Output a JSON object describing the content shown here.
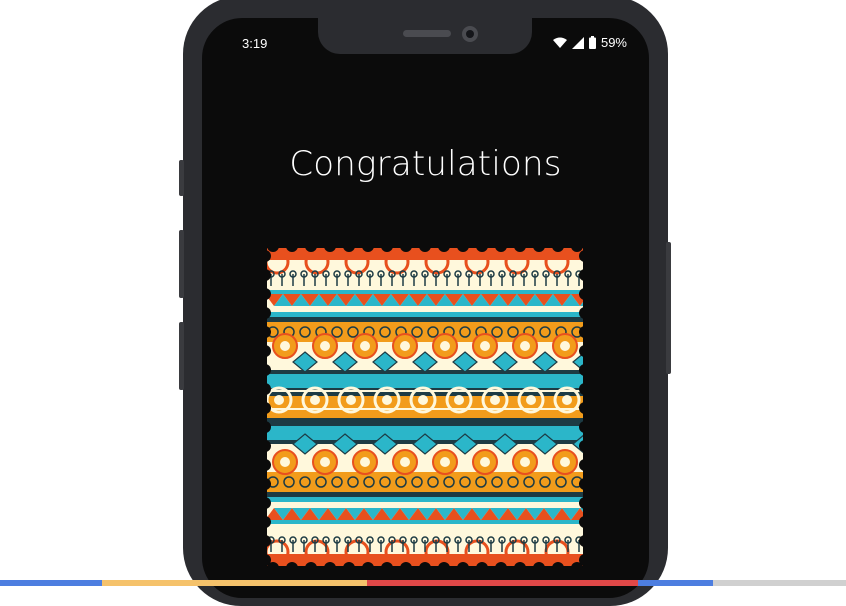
{
  "status_bar": {
    "time": "3:19",
    "battery": "59%",
    "icons": [
      "wifi-icon",
      "cellular-signal-icon",
      "battery-icon"
    ]
  },
  "screen": {
    "title": "Congratulations"
  },
  "stamp": {
    "icon": "tribal-pattern-stamp",
    "colors": [
      "#e8501e",
      "#f29c1b",
      "#2bb6c9",
      "#fff8dc",
      "#1d3b44"
    ]
  },
  "bottom_bar_colors": [
    "#4d7ee0",
    "#f5c26b",
    "#e04848",
    "#4d7ee0",
    "#d0d0d0"
  ]
}
